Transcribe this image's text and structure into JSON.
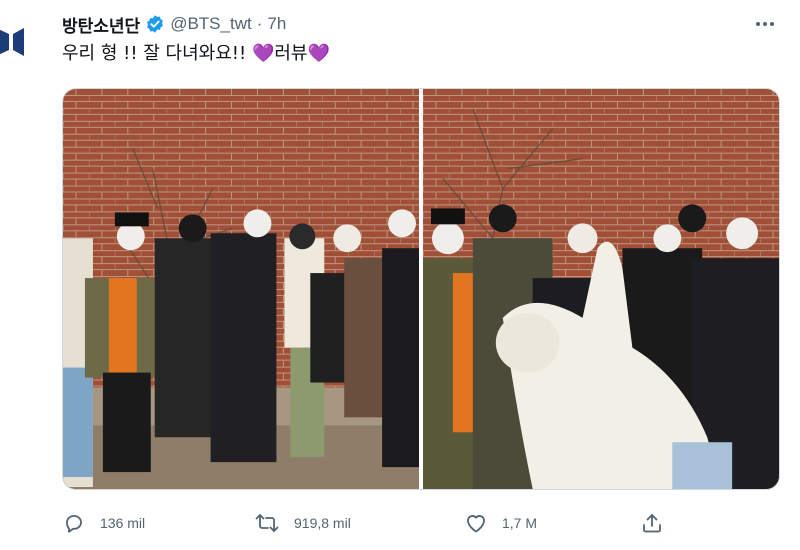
{
  "tweet": {
    "display_name": "방탄소년단",
    "handle": "@BTS_twt",
    "separator": "·",
    "time": "7h",
    "text_main": "우리 형 !! 잘 다녀와요!! ",
    "heart_1": "💜",
    "text_sign": "러뷰",
    "heart_2": "💜"
  },
  "icons": {
    "avatar": "bts-logo-icon",
    "verified": "verified-badge-icon",
    "more": "more-options-icon",
    "reply": "reply-icon",
    "retweet": "retweet-icon",
    "like": "like-icon",
    "share": "share-icon"
  },
  "stats": {
    "replies": "136 mil",
    "retweets": "919,8 mil",
    "likes": "1,7 M"
  },
  "colors": {
    "accent": "#1d9bf0",
    "muted": "#536471",
    "heart": "#a97ee0"
  }
}
